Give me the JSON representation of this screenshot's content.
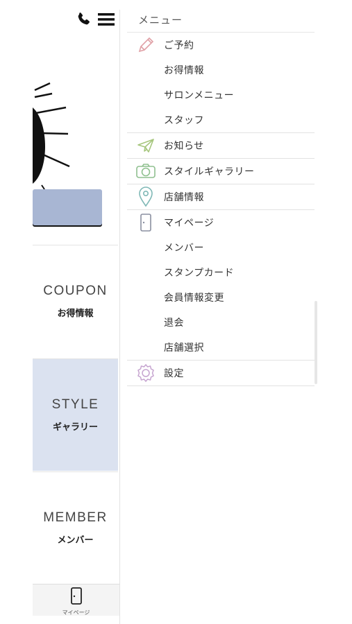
{
  "underlying_page": {
    "icons": [
      "phone-icon",
      "hamburger-menu-icon"
    ],
    "tiles": [
      {
        "en": "COUPON",
        "jp": "お得情報"
      },
      {
        "en": "STYLE",
        "jp": "ギャラリー"
      },
      {
        "en": "MEMBER",
        "jp": "メンバー"
      }
    ],
    "tabbar": {
      "label": "マイページ",
      "icon": "door-icon"
    }
  },
  "drawer": {
    "title": "メニュー",
    "groups": [
      {
        "items": [
          {
            "label": "ご予約",
            "icon": "pencil-icon"
          },
          {
            "label": "お得情報",
            "icon": ""
          },
          {
            "label": "サロンメニュー",
            "icon": ""
          },
          {
            "label": "スタッフ",
            "icon": ""
          }
        ]
      },
      {
        "items": [
          {
            "label": "お知らせ",
            "icon": "paper-plane-icon"
          }
        ]
      },
      {
        "items": [
          {
            "label": "スタイルギャラリー",
            "icon": "camera-icon"
          }
        ]
      },
      {
        "items": [
          {
            "label": "店舗情報",
            "icon": "map-pin-icon"
          }
        ]
      },
      {
        "items": [
          {
            "label": "マイページ",
            "icon": "door-icon"
          },
          {
            "label": "メンバー",
            "icon": ""
          },
          {
            "label": "スタンプカード",
            "icon": ""
          },
          {
            "label": "会員情報変更",
            "icon": ""
          },
          {
            "label": "退会",
            "icon": ""
          },
          {
            "label": "店舗選択",
            "icon": ""
          }
        ]
      },
      {
        "items": [
          {
            "label": "設定",
            "icon": "gear-icon"
          }
        ]
      }
    ]
  },
  "colors": {
    "tile_highlight": "#dbe2f0",
    "hero_button": "#a8b6d3",
    "icon_pencil": "#e0a0a6",
    "icon_plane": "#a6c67d",
    "icon_camera": "#8fc08f",
    "icon_pin": "#7fb8b6",
    "icon_door": "#8a8fa0",
    "icon_gear": "#c6a4d0"
  }
}
